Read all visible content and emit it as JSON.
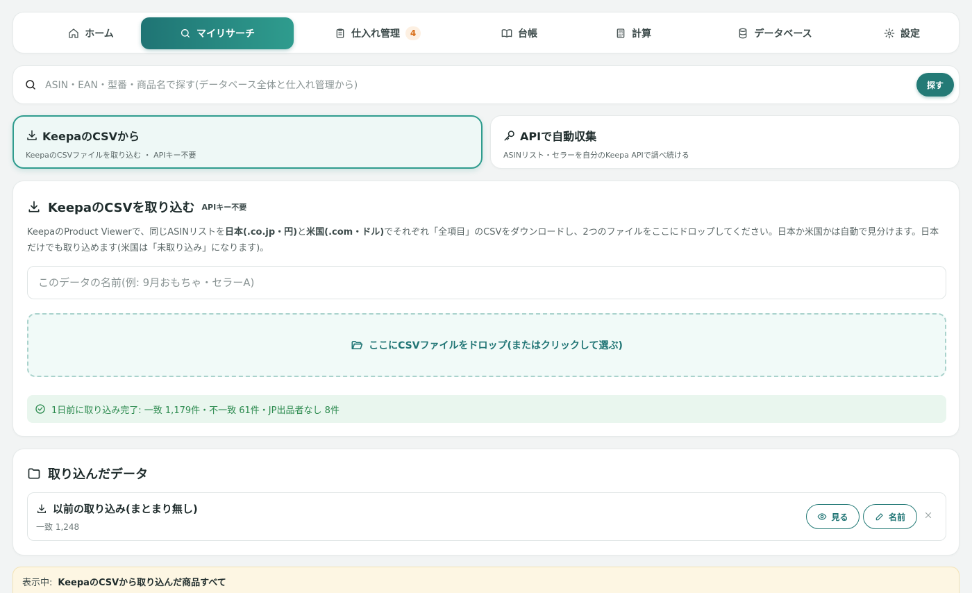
{
  "nav": {
    "items": [
      {
        "label": "ホーム",
        "icon": "home-icon"
      },
      {
        "label": "マイリサーチ",
        "icon": "search-icon",
        "active": true
      },
      {
        "label": "仕入れ管理",
        "icon": "clipboard-icon",
        "badge": "4"
      },
      {
        "label": "台帳",
        "icon": "book-icon"
      },
      {
        "label": "計算",
        "icon": "calculator-icon"
      },
      {
        "label": "データベース",
        "icon": "database-icon"
      },
      {
        "label": "設定",
        "icon": "gear-icon"
      }
    ]
  },
  "search": {
    "placeholder": "ASIN・EAN・型番・商品名で探す(データベース全体と仕入れ管理から)",
    "button_label": "探す"
  },
  "modes": {
    "csv": {
      "title": "KeepaのCSVから",
      "subtitle": "KeepaのCSVファイルを取り込む ・ APIキー不要"
    },
    "api": {
      "title": "APIで自動収集",
      "subtitle": "ASINリスト・セラーを自分のKeepa APIで調べ続ける"
    }
  },
  "import": {
    "title": "KeepaのCSVを取り込む",
    "tag": "APIキー不要",
    "desc_part1": "KeepaのProduct Viewerで、同じASINリストを",
    "desc_bold1": "日本(.co.jp・円)",
    "desc_part2": "と",
    "desc_bold2": "米国(.com・ドル)",
    "desc_part3": "でそれぞれ「全項目」のCSVをダウンロードし、2つのファイルをここにドロップしてください。日本か米国かは自動で見分けます。日本だけでも取り込めます(米国は「未取り込み」になります)。",
    "name_placeholder": "このデータの名前(例: 9月おもちゃ・セラーA)",
    "dropzone_label": "ここにCSVファイルをドロップ(またはクリックして選ぶ)",
    "status": "1日前に取り込み完了: 一致 1,179件・不一致 61件・JP出品者なし 8件"
  },
  "imported": {
    "title": "取り込んだデータ",
    "items": [
      {
        "title": "以前の取り込み(まとまり無し)",
        "subtitle": "一致 1,248",
        "view_label": "見る",
        "rename_label": "名前"
      }
    ]
  },
  "showing": {
    "label": "表示中:",
    "value": "KeepaのCSVから取り込んだ商品すべて"
  },
  "colors": {
    "accent": "#237a76",
    "accent_light": "#2f9c8e",
    "success": "#2b8a4e",
    "badge": "#d86f1a"
  }
}
